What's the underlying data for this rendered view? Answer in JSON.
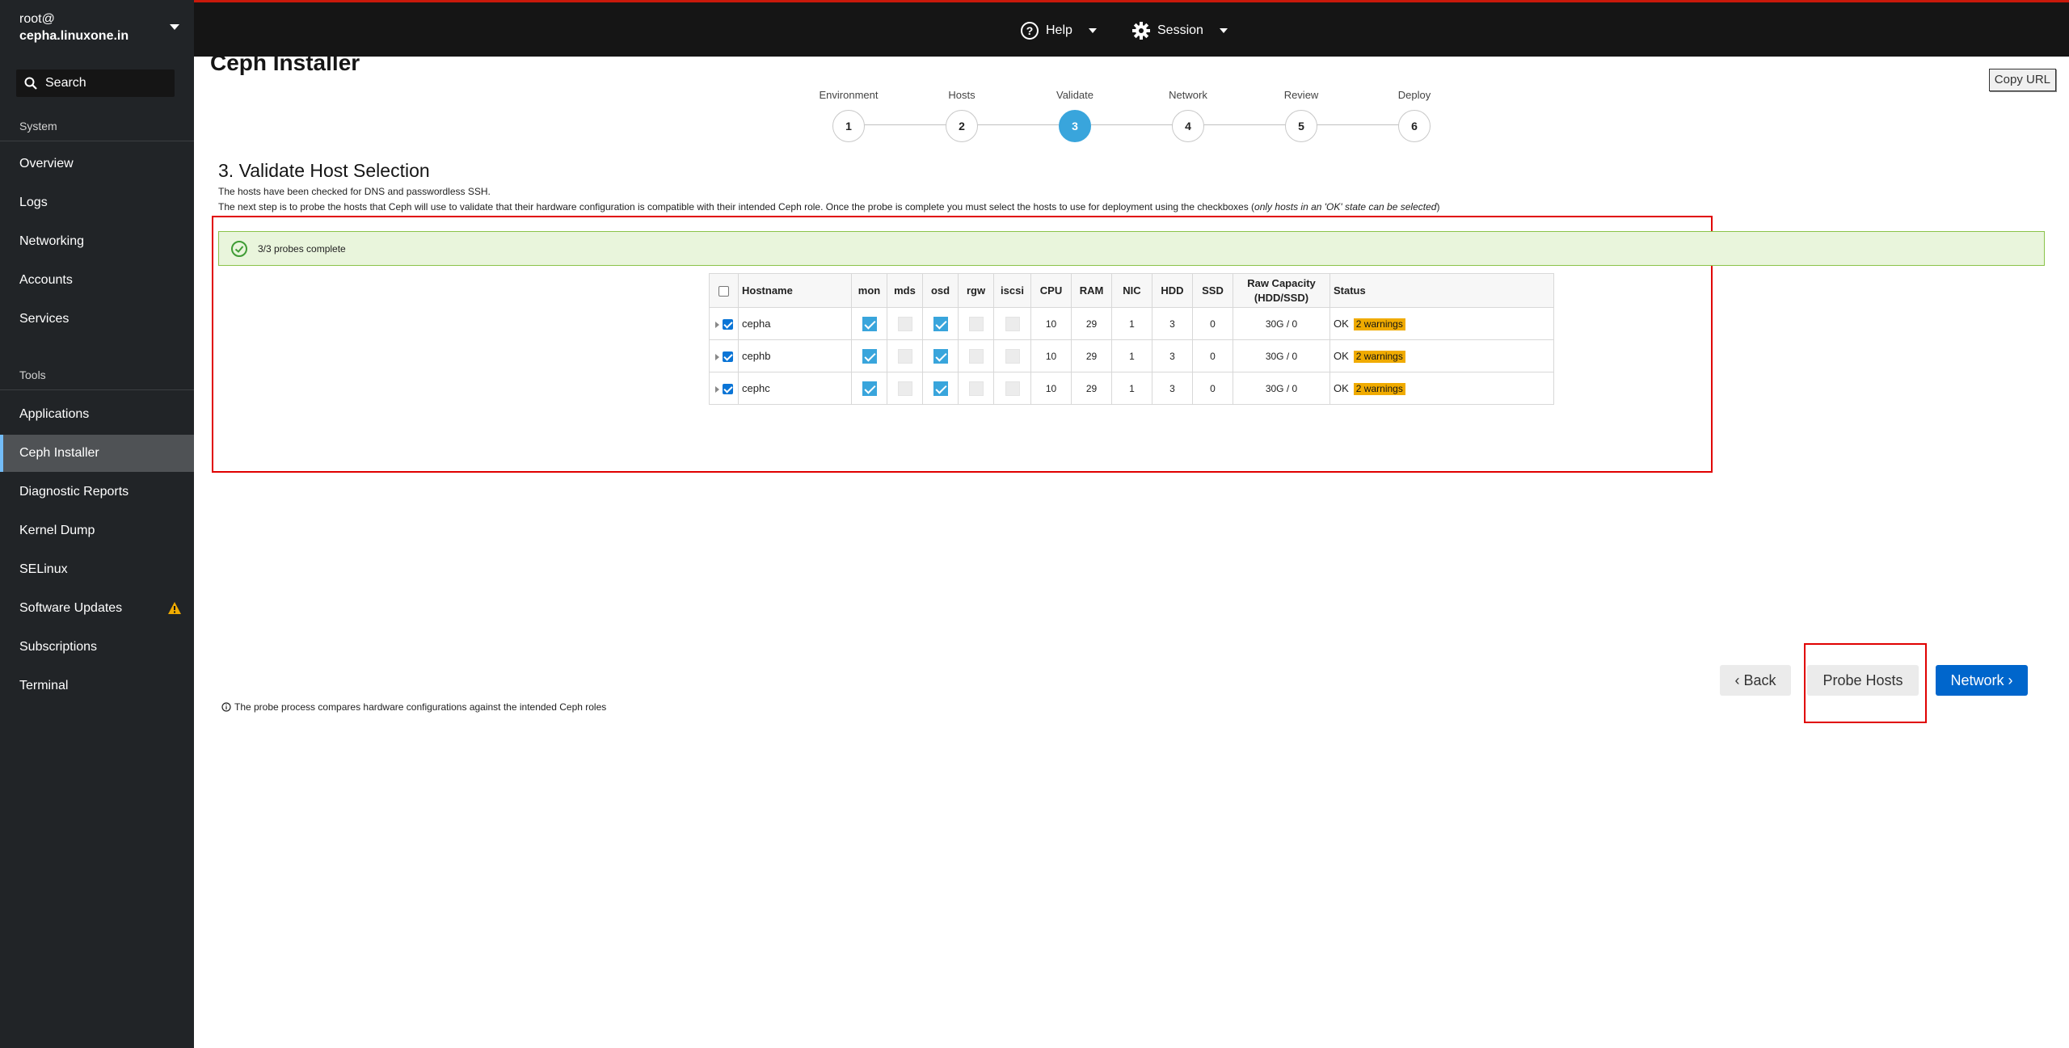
{
  "sidebar": {
    "host_user": "root@",
    "host_name": "cepha.linuxone.in",
    "search_label": "Search",
    "system_heading": "System",
    "system_items": [
      "Overview",
      "Logs",
      "Networking",
      "Accounts",
      "Services"
    ],
    "tools_heading": "Tools",
    "tools_items": [
      "Applications",
      "Ceph Installer",
      "Diagnostic Reports",
      "Kernel Dump",
      "SELinux",
      "Software Updates",
      "Subscriptions",
      "Terminal"
    ],
    "active_item": "Ceph Installer"
  },
  "topbar": {
    "help_label": "Help",
    "session_label": "Session"
  },
  "page": {
    "title": "Ceph Installer",
    "copy_url_label": "Copy URL"
  },
  "wizard": {
    "steps": [
      {
        "label": "Environment",
        "number": "1"
      },
      {
        "label": "Hosts",
        "number": "2"
      },
      {
        "label": "Validate",
        "number": "3"
      },
      {
        "label": "Network",
        "number": "4"
      },
      {
        "label": "Review",
        "number": "5"
      },
      {
        "label": "Deploy",
        "number": "6"
      }
    ],
    "active_step": 3
  },
  "validate": {
    "title": "3. Validate Host Selection",
    "desc_line1": "The hosts have been checked for DNS and passwordless SSH.",
    "desc_line2_prefix": "The next step is to probe the hosts that Ceph will use to validate that their hardware configuration is compatible with their intended Ceph role. Once the probe is complete you must select the hosts to use for deployment using the checkboxes (",
    "desc_line2_italic": "only hosts in an 'OK' state can be selected",
    "desc_line2_suffix": ")",
    "probe_status": "3/3 probes complete",
    "info_note": "The probe process compares hardware configurations against the intended Ceph roles"
  },
  "table": {
    "headers": {
      "hostname": "Hostname",
      "mon": "mon",
      "mds": "mds",
      "osd": "osd",
      "rgw": "rgw",
      "iscsi": "iscsi",
      "cpu": "CPU",
      "ram": "RAM",
      "nic": "NIC",
      "hdd": "HDD",
      "ssd": "SSD",
      "raw_capacity_1": "Raw Capacity",
      "raw_capacity_2": "(HDD/SSD)",
      "status": "Status"
    },
    "rows": [
      {
        "hostname": "cepha",
        "cpu": "10",
        "ram": "29",
        "nic": "1",
        "hdd": "3",
        "ssd": "0",
        "capacity": "30G / 0",
        "status": "OK",
        "warnings": "2 warnings"
      },
      {
        "hostname": "cephb",
        "cpu": "10",
        "ram": "29",
        "nic": "1",
        "hdd": "3",
        "ssd": "0",
        "capacity": "30G / 0",
        "status": "OK",
        "warnings": "2 warnings"
      },
      {
        "hostname": "cephc",
        "cpu": "10",
        "ram": "29",
        "nic": "1",
        "hdd": "3",
        "ssd": "0",
        "capacity": "30G / 0",
        "status": "OK",
        "warnings": "2 warnings"
      }
    ]
  },
  "buttons": {
    "back_label": "‹ Back",
    "probe_label": "Probe Hosts",
    "next_label": "Network ›"
  },
  "colors": {
    "accent_blue": "#39a5dc",
    "primary_button": "#0066cc",
    "warning": "#f0ab00",
    "highlight": "#e00000",
    "success_bg": "#e9f5dc"
  }
}
